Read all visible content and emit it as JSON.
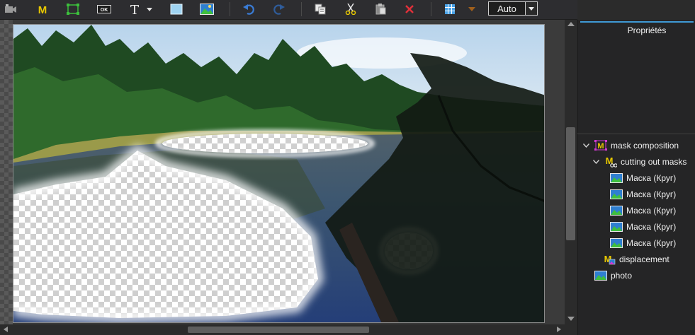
{
  "toolbar": {
    "zoom_value": "Auto",
    "icons": [
      "video-camera-icon",
      "mask-m-icon",
      "selection-rect-icon",
      "ok-button-icon",
      "text-tool-icon",
      "dropdown-arrow-icon",
      "rectangle-icon",
      "image-icon",
      "undo-icon",
      "redo-icon",
      "copy-icon",
      "cut-icon",
      "paste-icon",
      "delete-icon",
      "grid-icon",
      "color-dropdown-icon"
    ]
  },
  "properties": {
    "tab_label": "Propriétés"
  },
  "tree": {
    "items": [
      {
        "label": "mask composition",
        "level": 0,
        "expanded": true
      },
      {
        "label": "cutting out masks",
        "level": 1,
        "expanded": true
      },
      {
        "label": "Маска (Круг)",
        "level": 2
      },
      {
        "label": "Маска (Круг)",
        "level": 2
      },
      {
        "label": "Маска (Круг)",
        "level": 2
      },
      {
        "label": "Маска (Круг)",
        "level": 2
      },
      {
        "label": "Маска (Круг)",
        "level": 2
      },
      {
        "label": "displacement",
        "level": 1
      },
      {
        "label": "photo",
        "level": 0
      }
    ]
  },
  "colors": {
    "accent_blue": "#3f9ad6",
    "delete_red": "#e0303a",
    "mask_icon_yellow": "#e8c800"
  }
}
